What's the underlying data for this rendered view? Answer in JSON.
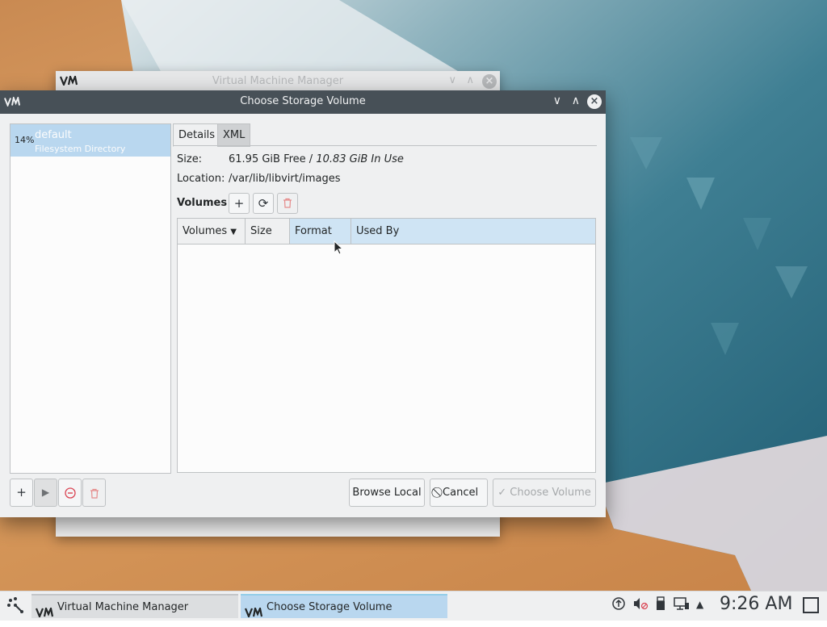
{
  "background_window": {
    "title": "Virtual Machine Manager"
  },
  "dialog": {
    "title": "Choose Storage Volume",
    "pools": [
      {
        "usage": "14%",
        "name": "default",
        "type": "Filesystem Directory"
      }
    ],
    "tabs": [
      {
        "label": "Details",
        "active": true
      },
      {
        "label": "XML",
        "active": false
      }
    ],
    "details": {
      "size_label": "Size:",
      "size_free": "61.95 GiB Free / ",
      "size_in_use": "10.83 GiB In Use",
      "location_label": "Location:",
      "location_value": "/var/lib/libvirt/images",
      "volumes_label": "Volumes"
    },
    "table": {
      "columns": [
        {
          "label": "Volumes",
          "sorted": true
        },
        {
          "label": "Size"
        },
        {
          "label": "Format",
          "selected": true
        },
        {
          "label": "Used By"
        }
      ],
      "rows": []
    },
    "buttons": {
      "browse_local": "Browse Local",
      "cancel": "Cancel",
      "choose_volume": "Choose Volume"
    }
  },
  "taskbar": {
    "tasks": [
      {
        "label": "Virtual Machine Manager",
        "active": false
      },
      {
        "label": "Choose Storage Volume",
        "active": true
      }
    ],
    "clock": "9:26 AM"
  },
  "colors": {
    "selection": "#b9d7ef",
    "titlebar": "#475057",
    "window_bg": "#eff0f1",
    "accent": "#3daee9"
  }
}
